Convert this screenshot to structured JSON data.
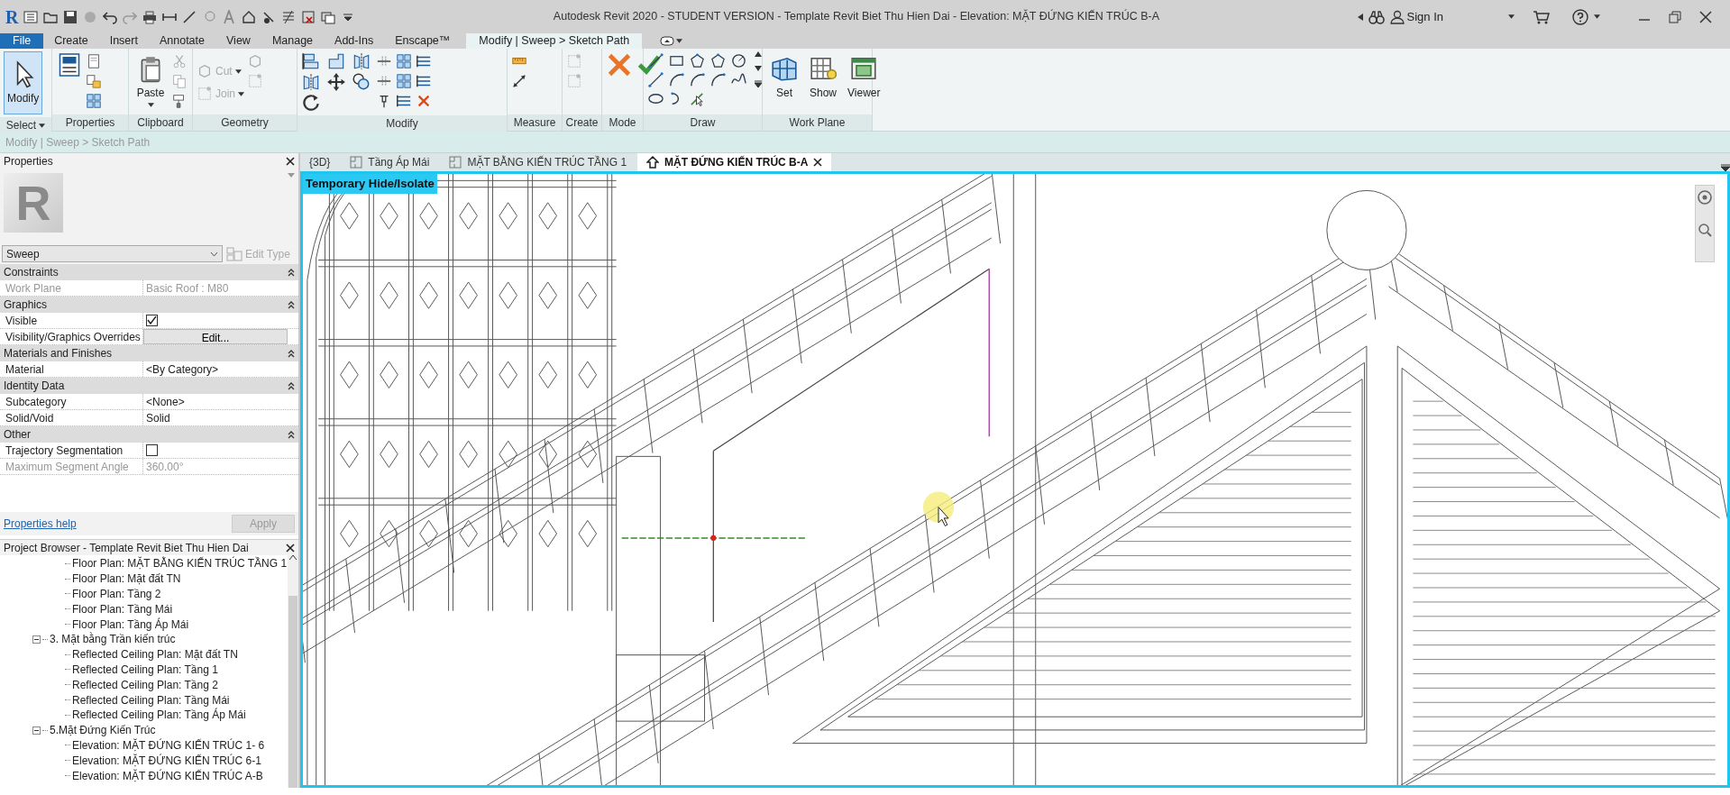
{
  "title_bar": {
    "app_logo": "R",
    "title": "Autodesk Revit 2020 - STUDENT VERSION - Template Revit Biet Thu Hien Dai - Elevation: MẶT ĐỨNG KIẾN TRÚC B-A",
    "sign_in": "Sign In"
  },
  "ribbon_tabs": [
    {
      "label": "File",
      "kind": "file",
      "selected": false
    },
    {
      "label": "Create",
      "kind": "tab",
      "selected": false
    },
    {
      "label": "Insert",
      "kind": "tab",
      "selected": false
    },
    {
      "label": "Annotate",
      "kind": "tab",
      "selected": false
    },
    {
      "label": "View",
      "kind": "tab",
      "selected": false
    },
    {
      "label": "Manage",
      "kind": "tab",
      "selected": false
    },
    {
      "label": "Add-Ins",
      "kind": "tab",
      "selected": false
    },
    {
      "label": "Enscape™",
      "kind": "tab",
      "selected": false
    },
    {
      "label": "Modify | Sweep > Sketch Path",
      "kind": "context",
      "selected": true
    }
  ],
  "ribbon_panels": [
    {
      "label": "Select",
      "dropdown": true,
      "buttons": [
        {
          "label": "Modify"
        }
      ]
    },
    {
      "label": "Properties"
    },
    {
      "label": "Clipboard",
      "buttons": [
        {
          "label": "Paste"
        }
      ]
    },
    {
      "label": "Geometry",
      "buttons": [
        {
          "label": "Cut",
          "disabled": true
        },
        {
          "label": "Join",
          "disabled": true
        }
      ]
    },
    {
      "label": "Modify"
    },
    {
      "label": "Measure"
    },
    {
      "label": "Create"
    },
    {
      "label": "Mode"
    },
    {
      "label": "Draw"
    },
    {
      "label": "Work Plane",
      "buttons": [
        {
          "label": "Set"
        },
        {
          "label": "Show"
        },
        {
          "label": "Viewer"
        }
      ]
    }
  ],
  "options_bar": {
    "text": "Modify | Sweep > Sketch Path"
  },
  "properties": {
    "title": "Properties",
    "type_image_letter": "R",
    "type_name": "Sweep",
    "edit_type": "Edit Type",
    "groups": [
      {
        "name": "Constraints",
        "rows": [
          {
            "label": "Work Plane",
            "value": "Basic Roof : M80",
            "kind": "text",
            "disabled": true
          }
        ]
      },
      {
        "name": "Graphics",
        "rows": [
          {
            "label": "Visible",
            "kind": "checkbox",
            "checked": true
          },
          {
            "label": "Visibility/Graphics Overrides",
            "value": "Edit...",
            "kind": "button"
          }
        ]
      },
      {
        "name": "Materials and Finishes",
        "rows": [
          {
            "label": "Material",
            "value": "<By Category>",
            "kind": "text"
          }
        ]
      },
      {
        "name": "Identity Data",
        "rows": [
          {
            "label": "Subcategory",
            "value": "<None>",
            "kind": "text"
          },
          {
            "label": "Solid/Void",
            "value": "Solid",
            "kind": "text"
          }
        ]
      },
      {
        "name": "Other",
        "rows": [
          {
            "label": "Trajectory Segmentation",
            "kind": "checkbox",
            "checked": false
          },
          {
            "label": "Maximum Segment Angle",
            "value": "360.00°",
            "kind": "text",
            "disabled": true
          }
        ]
      }
    ],
    "help": "Properties help",
    "apply": "Apply"
  },
  "project_browser": {
    "title": "Project Browser - Template Revit Biet Thu Hien Dai",
    "items": [
      {
        "label": "Floor Plan: MẶT BẰNG KIẾN TRÚC TẦNG 1"
      },
      {
        "label": "Floor Plan: Mặt đất TN"
      },
      {
        "label": "Floor Plan: Tầng 2"
      },
      {
        "label": "Floor Plan: Tầng Mái"
      },
      {
        "label": "Floor Plan: Tầng Áp Mái"
      },
      {
        "label": "3. Mặt bằng Trần kiến trúc",
        "expanded": true,
        "children": [
          {
            "label": "Reflected Ceiling Plan: Mặt đất TN"
          },
          {
            "label": "Reflected Ceiling Plan: Tầng 1"
          },
          {
            "label": "Reflected Ceiling Plan: Tầng 2"
          },
          {
            "label": "Reflected Ceiling Plan: Tầng Mái"
          },
          {
            "label": "Reflected Ceiling Plan: Tầng Áp Mái"
          }
        ]
      },
      {
        "label": "5.Mặt Đứng Kiến Trúc",
        "expanded": true,
        "children": [
          {
            "label": "Elevation: MẶT ĐỨNG KIẾN TRÚC 1- 6"
          },
          {
            "label": "Elevation: MẶT ĐỨNG KIẾN TRÚC 6-1"
          },
          {
            "label": "Elevation: MẶT ĐỨNG KIẾN TRÚC A-B"
          }
        ]
      }
    ]
  },
  "view_tabs": [
    {
      "label": "{3D}",
      "kind": "model",
      "selected": false
    },
    {
      "label": "Tầng Áp Mái",
      "kind": "plan",
      "selected": false
    },
    {
      "label": "MẶT BẰNG KIẾN TRÚC TẦNG 1",
      "kind": "plan",
      "selected": false
    },
    {
      "label": "MẶT ĐỨNG KIẾN TRÚC B-A",
      "kind": "elevation",
      "selected": true
    }
  ],
  "view": {
    "mode_badge": "Temporary Hide/Isolate"
  }
}
